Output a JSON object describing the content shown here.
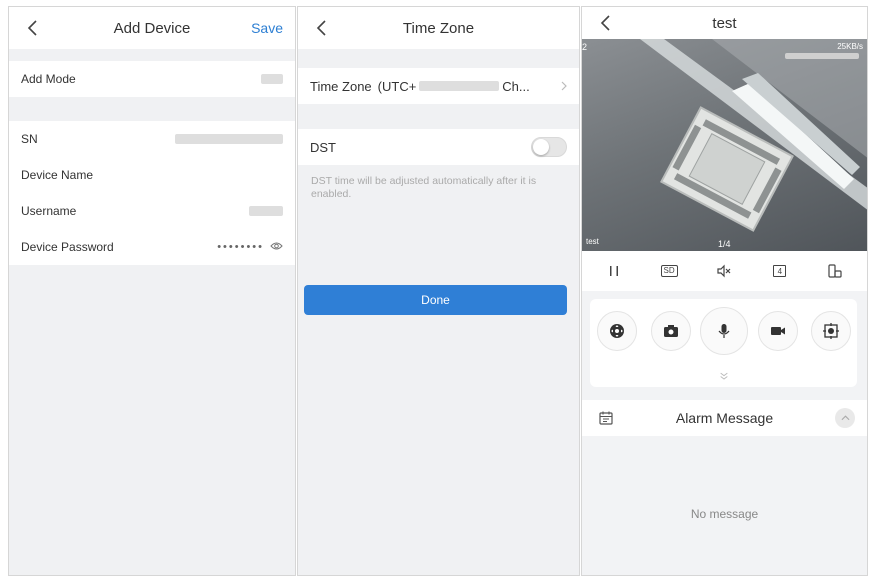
{
  "add_device": {
    "title": "Add Device",
    "save_label": "Save",
    "fields": [
      {
        "label": "Add Mode"
      },
      {
        "label": "SN"
      },
      {
        "label": "Device Name"
      },
      {
        "label": "Username"
      },
      {
        "label": "Device Password",
        "value": "••••••••"
      }
    ]
  },
  "time_zone": {
    "title": "Time Zone",
    "tz_label": "Time Zone",
    "tz_value_prefix": "(UTC+",
    "tz_value_suffix": "Ch...",
    "dst_label": "DST",
    "dst_enabled": false,
    "dst_description": "DST time will be adjusted automatically after it is enabled.",
    "done_label": "Done"
  },
  "live_view": {
    "title": "test",
    "channel": "2",
    "bitrate": "25KB/s",
    "overlay_name": "test",
    "page": "1/4",
    "controls": {
      "pause_icon": "pause-icon",
      "sd_label": "SD",
      "mute_icon": "speaker-mute-icon",
      "grid_label": "4",
      "device_icon": "device-icon"
    },
    "actions": [
      "ptz-icon",
      "camera-icon",
      "microphone-icon",
      "video-record-icon",
      "snapshot-target-icon"
    ],
    "alarm_title": "Alarm Message",
    "no_message": "No message"
  },
  "colors": {
    "accent": "#2d7fd3",
    "button": "#2f7fd6",
    "background": "#f0f1f3"
  }
}
